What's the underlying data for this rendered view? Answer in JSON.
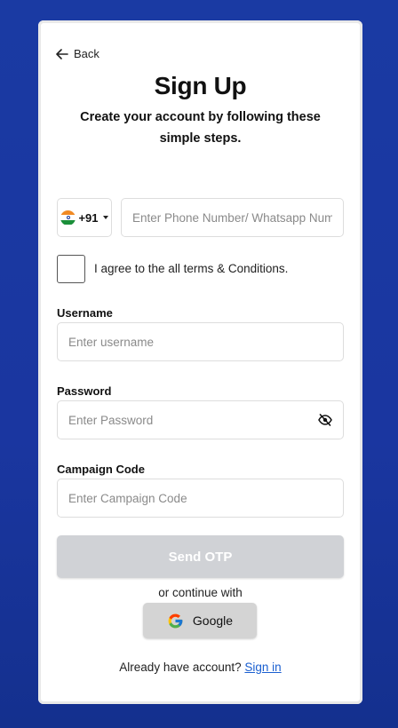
{
  "back_label": "Back",
  "title": "Sign Up",
  "subtitle": "Create your account by following these simple steps.",
  "country": {
    "code": "+91",
    "flag": "india-flag-icon"
  },
  "phone": {
    "placeholder": "Enter Phone Number/ Whatsapp Number",
    "value": ""
  },
  "terms": {
    "label": "I agree to the all terms & Conditions.",
    "checked": false
  },
  "username": {
    "label": "Username",
    "placeholder": "Enter username",
    "value": ""
  },
  "password": {
    "label": "Password",
    "placeholder": "Enter Password",
    "value": ""
  },
  "campaign": {
    "label": "Campaign Code",
    "placeholder": "Enter Campaign Code",
    "value": ""
  },
  "send_otp_label": "Send OTP",
  "continue_with": "or continue with",
  "google_label": "Google",
  "footer": {
    "text": "Already have account?",
    "link": "Sign in"
  },
  "colors": {
    "background": "#1a3aa3",
    "button_disabled": "#d0d2d6",
    "link": "#1a5fd0"
  }
}
